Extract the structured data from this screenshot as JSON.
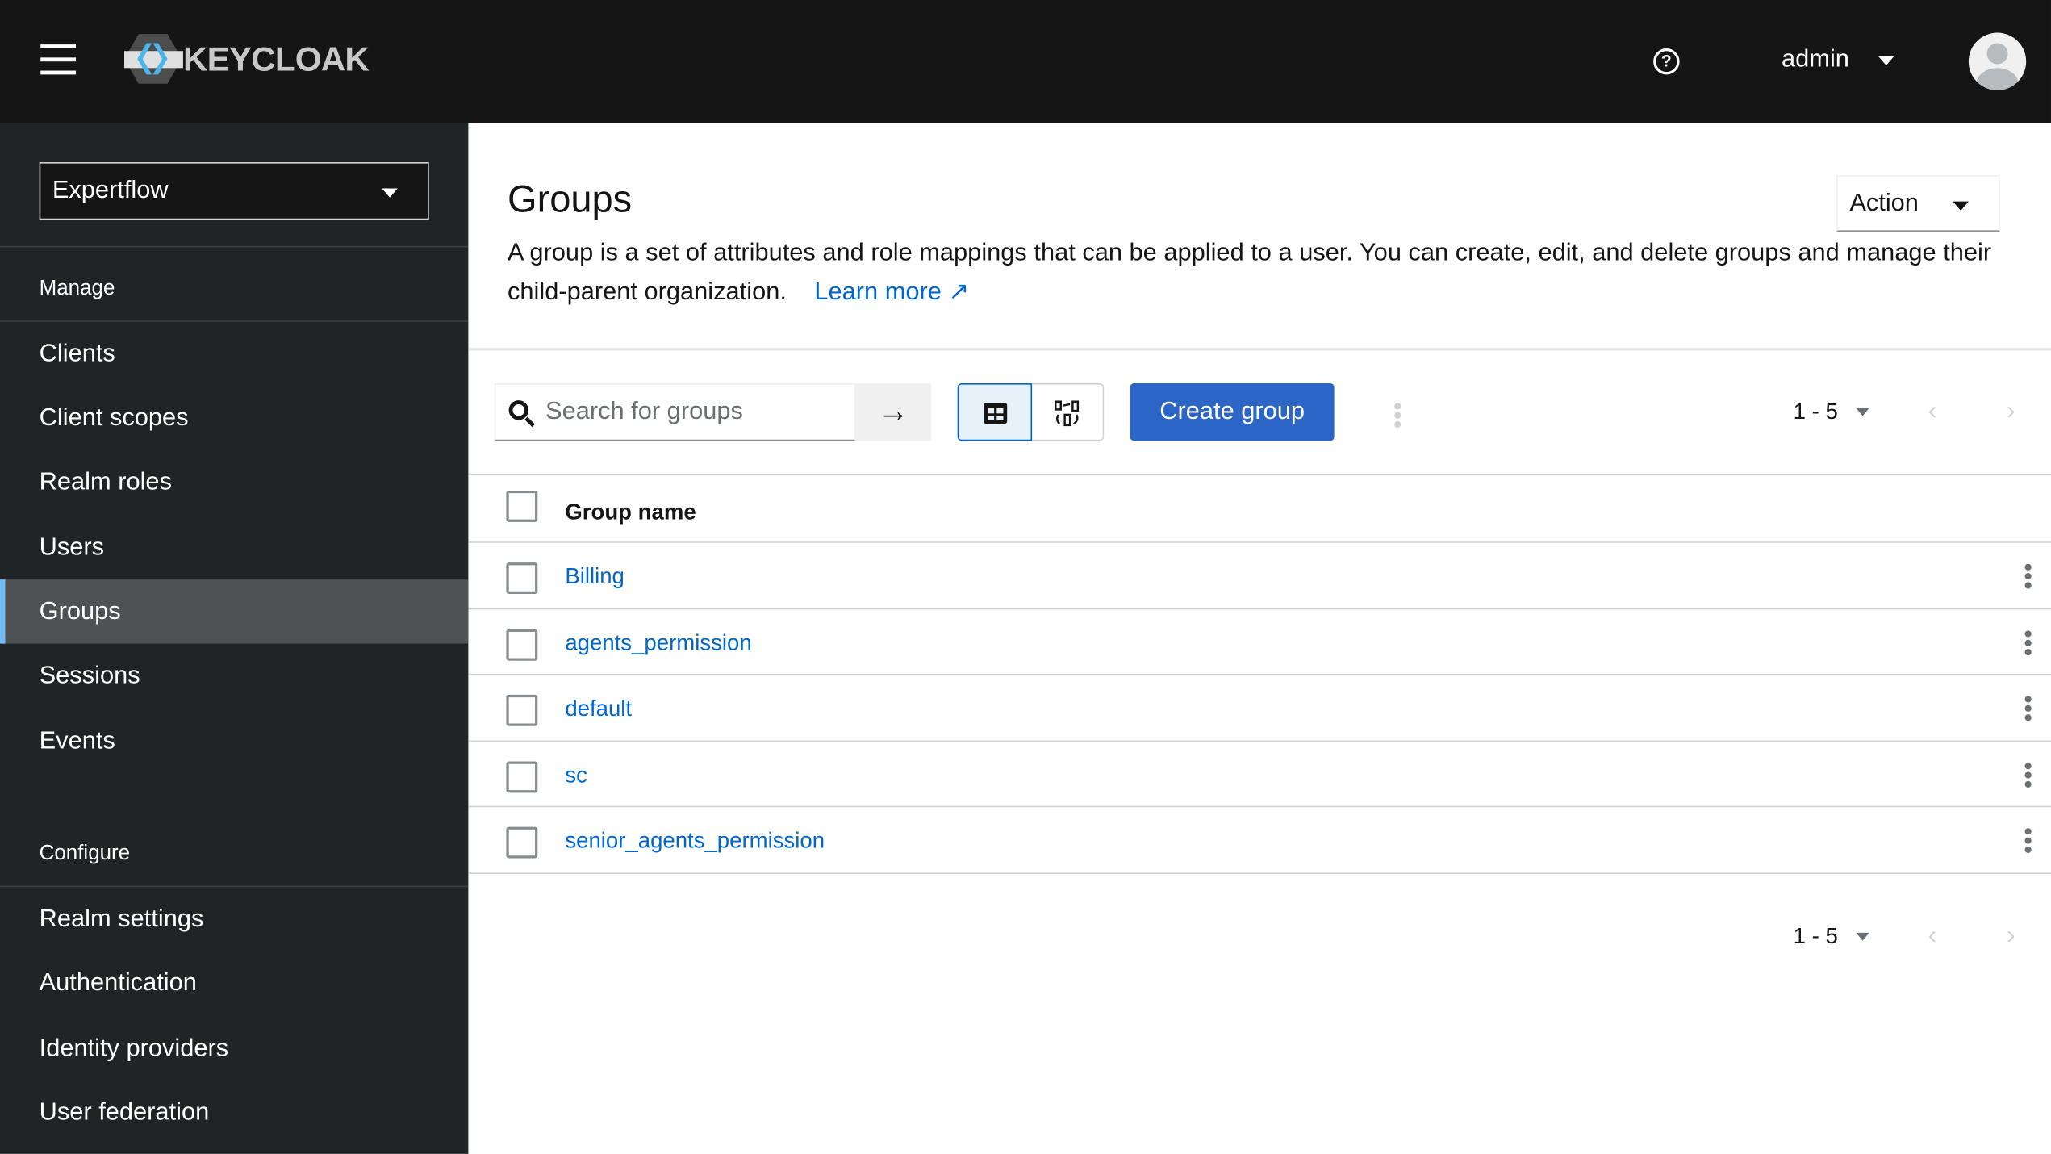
{
  "header": {
    "brand": "KEYCLOAK",
    "user": "admin",
    "icons": {
      "menu": "hamburger-icon",
      "help": "help-circle-icon",
      "user": "avatar"
    }
  },
  "sidebar": {
    "realm": "Expertflow",
    "manage_label": "Manage",
    "manage_items": [
      {
        "label": "Clients"
      },
      {
        "label": "Client scopes"
      },
      {
        "label": "Realm roles"
      },
      {
        "label": "Users"
      },
      {
        "label": "Groups",
        "active": true
      },
      {
        "label": "Sessions"
      },
      {
        "label": "Events"
      }
    ],
    "configure_label": "Configure",
    "configure_items": [
      {
        "label": "Realm settings"
      },
      {
        "label": "Authentication"
      },
      {
        "label": "Identity providers"
      },
      {
        "label": "User federation"
      }
    ]
  },
  "page": {
    "title": "Groups",
    "action_label": "Action",
    "description": "A group is a set of attributes and role mappings that can be applied to a user. You can create, edit, and delete groups and manage their child-parent organization.",
    "learn_more": "Learn more"
  },
  "toolbar": {
    "search_placeholder": "Search for groups",
    "create_label": "Create group",
    "pagination": "1 - 5"
  },
  "table": {
    "column": "Group name",
    "rows": [
      "Billing",
      "agents_permission",
      "default",
      "sc",
      "senior_agents_permission"
    ]
  },
  "footer": {
    "pagination": "1 - 5"
  },
  "colors": {
    "primary": "#0066cc",
    "header": "#151515",
    "sidebar": "#212427",
    "active": "#73bcf7"
  }
}
